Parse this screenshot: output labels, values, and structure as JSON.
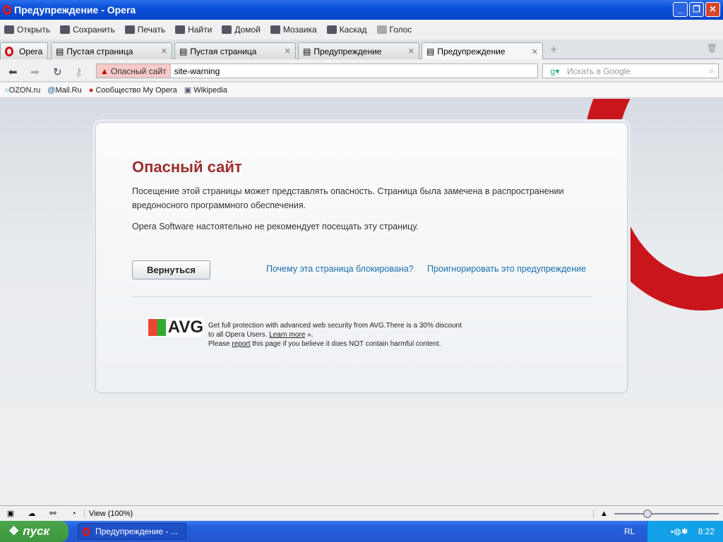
{
  "window": {
    "title": "Предупреждение - Opera"
  },
  "toolbar": [
    "Открыть",
    "Сохранить",
    "Печать",
    "Найти",
    "Домой",
    "Мозаика",
    "Каскад",
    "Голос"
  ],
  "menu_button": "Opera",
  "tabs": [
    {
      "label": "Пустая страница"
    },
    {
      "label": "Пустая страница"
    },
    {
      "label": "Предупреждение"
    },
    {
      "label": "Предупреждение"
    }
  ],
  "address": {
    "badge": "Опасный сайт",
    "url": "site-warning",
    "search_placeholder": "Искать в Google"
  },
  "bookmarks": [
    "OZON.ru",
    "Mail.Ru",
    "Сообщество My Opera",
    "Wikipedia"
  ],
  "page": {
    "title": "Опасный сайт",
    "p1": "Посещение этой страницы может представлять опасность. Страница была замечена в распространении вредоносного программного обеспечения.",
    "p2": "Opera Software настоятельно не рекомендует посещать эту страницу.",
    "back": "Вернуться",
    "why": "Почему эта страница блокирована?",
    "ignore": "Проигнорировать это предупреждение",
    "avg_logo": "AVG",
    "avg_l1": "Get full protection with advanced web security from AVG.There is a 30% discount",
    "avg_l2a": "to all Opera Users. ",
    "learn_more": "Learn more",
    "avg_l2b": " ».",
    "avg_l3a": "Please ",
    "report": "report",
    "avg_l3b": " this page if you believe it does NOT contain harmful content."
  },
  "status": {
    "view": "View (100%)",
    "zoom_level": 0.3
  },
  "taskbar": {
    "start": "пуск",
    "task": "Предупреждение - ...",
    "lang": "RL",
    "clock": "8:22"
  }
}
